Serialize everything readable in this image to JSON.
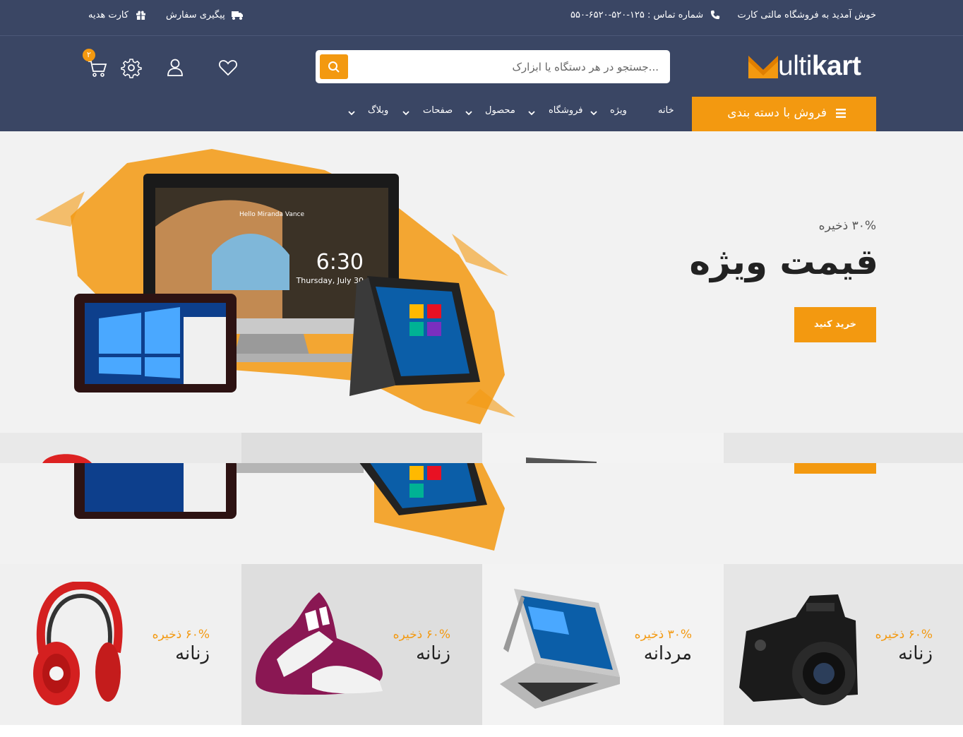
{
  "topbar": {
    "welcome": "خوش آمدید به فروشگاه مالتی کارت",
    "phone": "شماره تماس : ۱۲۵-۵۲۰-۶۵۲۰-۵۵۰",
    "track_order": "پیگیری سفارش",
    "gift_card": "کارت هدیه"
  },
  "header": {
    "logo_text_light": "ulti",
    "logo_text_bold": "kart",
    "search_placeholder": "...جستجو در هر دستگاه یا ابزارک",
    "cart_count": "۲"
  },
  "nav": {
    "category_button": "فروش با دسته بندی",
    "items": [
      "خانه",
      "ویژه",
      "فروشگاه",
      "محصول",
      "صفحات",
      "وبلاگ"
    ]
  },
  "hero": {
    "save_text": "۳۰% ذخیره",
    "title": "قیمت ویژه",
    "button": "خرید کنید",
    "screen_greeting": "Hello Miranda Vance",
    "screen_time": "6:30",
    "screen_date": "Thursday, July 30"
  },
  "tiles": [
    {
      "save": "۶۰% ذخیره",
      "name": "زنانه",
      "product": "camera"
    },
    {
      "save": "۳۰% ذخیره",
      "name": "مردانه",
      "product": "laptop"
    },
    {
      "save": "۶۰% ذخیره",
      "name": "زنانه",
      "product": "sneakers"
    },
    {
      "save": "۶۰% ذخیره",
      "name": "زنانه",
      "product": "headphones"
    }
  ],
  "colors": {
    "header_bg": "#3a4664",
    "accent": "#f39910",
    "hero_bg": "#f2f2f2"
  }
}
